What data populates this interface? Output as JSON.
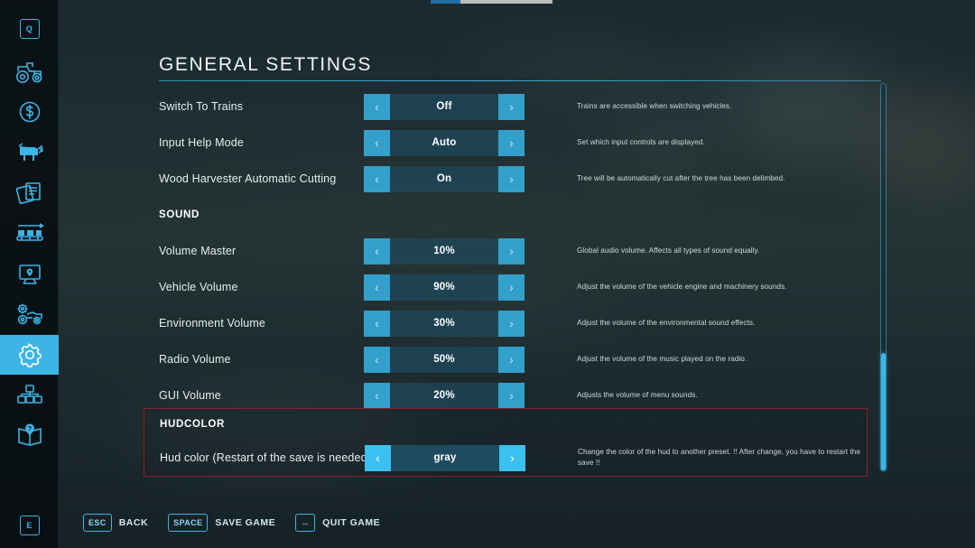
{
  "page": {
    "title": "GENERAL SETTINGS"
  },
  "top_strip": {
    "filled_color": "#1d6fa8",
    "rest_color": "#b9bfbf"
  },
  "theme": {
    "accent": "#3cb4e6",
    "arrow_button": "#35a8d6",
    "focus_arrow": "#3cc0ef",
    "highlight_border": "#8e1f1f",
    "selector_track": "#1e4a5e"
  },
  "sidebar": {
    "items": [
      {
        "icon": "keycap-q-icon",
        "label": "Q",
        "active": false
      },
      {
        "icon": "tractor-icon",
        "label": "Vehicles",
        "active": false
      },
      {
        "icon": "dollar-circle-icon",
        "label": "Finances",
        "active": false
      },
      {
        "icon": "cow-icon",
        "label": "Animals",
        "active": false
      },
      {
        "icon": "documents-icon",
        "label": "Contracts",
        "active": false
      },
      {
        "icon": "production-chain-icon",
        "label": "Production",
        "active": false
      },
      {
        "icon": "map-board-icon",
        "label": "Map",
        "active": false
      },
      {
        "icon": "vehicle-settings-icon",
        "label": "Vehicle Settings",
        "active": false
      },
      {
        "icon": "gear-icon",
        "label": "Game Settings",
        "active": true
      },
      {
        "icon": "nodes-icon",
        "label": "Multiplayer",
        "active": false
      },
      {
        "icon": "help-book-icon",
        "label": "Help",
        "active": false
      },
      {
        "icon": "keycap-e-icon",
        "label": "E",
        "active": false
      }
    ]
  },
  "settings": {
    "rows": [
      {
        "type": "option",
        "label": "Switch To Trains",
        "value": "Off",
        "left_arrow": "‹",
        "right_arrow": "›",
        "description": "Trains are accessible when switching vehicles."
      },
      {
        "type": "option",
        "label": "Input Help Mode",
        "value": "Auto",
        "left_arrow": "‹",
        "right_arrow": "›",
        "description": "Set which input controls are displayed."
      },
      {
        "type": "option",
        "label": "Wood Harvester Automatic Cutting",
        "value": "On",
        "left_arrow": "‹",
        "right_arrow": "›",
        "description": "Tree will be automatically cut after the tree has been delimbed."
      },
      {
        "type": "section",
        "label": "SOUND"
      },
      {
        "type": "option",
        "label": "Volume Master",
        "value": "10%",
        "left_arrow": "‹",
        "right_arrow": "›",
        "description": "Global audio volume. Affects all types of sound equally."
      },
      {
        "type": "option",
        "label": "Vehicle Volume",
        "value": "90%",
        "left_arrow": "‹",
        "right_arrow": "›",
        "description": "Adjust the volume of the vehicle engine and machinery sounds."
      },
      {
        "type": "option",
        "label": "Environment Volume",
        "value": "30%",
        "left_arrow": "‹",
        "right_arrow": "›",
        "description": "Adjust the volume of the environmental sound effects."
      },
      {
        "type": "option",
        "label": "Radio Volume",
        "value": "50%",
        "left_arrow": "‹",
        "right_arrow": "›",
        "description": "Adjust the volume of the music played on the radio."
      },
      {
        "type": "option",
        "label": "GUI Volume",
        "value": "20%",
        "left_arrow": "‹",
        "right_arrow": "›",
        "description": "Adjusts the volume of menu sounds."
      }
    ],
    "highlighted_block": {
      "section_label": "HUDCOLOR",
      "row": {
        "label": "Hud color (Restart of the save is needed !!)",
        "value": "gray",
        "left_arrow": "‹",
        "right_arrow": "›",
        "description": "Change the color of the hud to another preset. !! After change, you have to restart the save !!"
      }
    }
  },
  "footer": {
    "hints": [
      {
        "key": "ESC",
        "label": "BACK"
      },
      {
        "key": "SPACE",
        "label": "SAVE GAME"
      },
      {
        "key": "↔",
        "label": "QUIT GAME"
      }
    ]
  }
}
